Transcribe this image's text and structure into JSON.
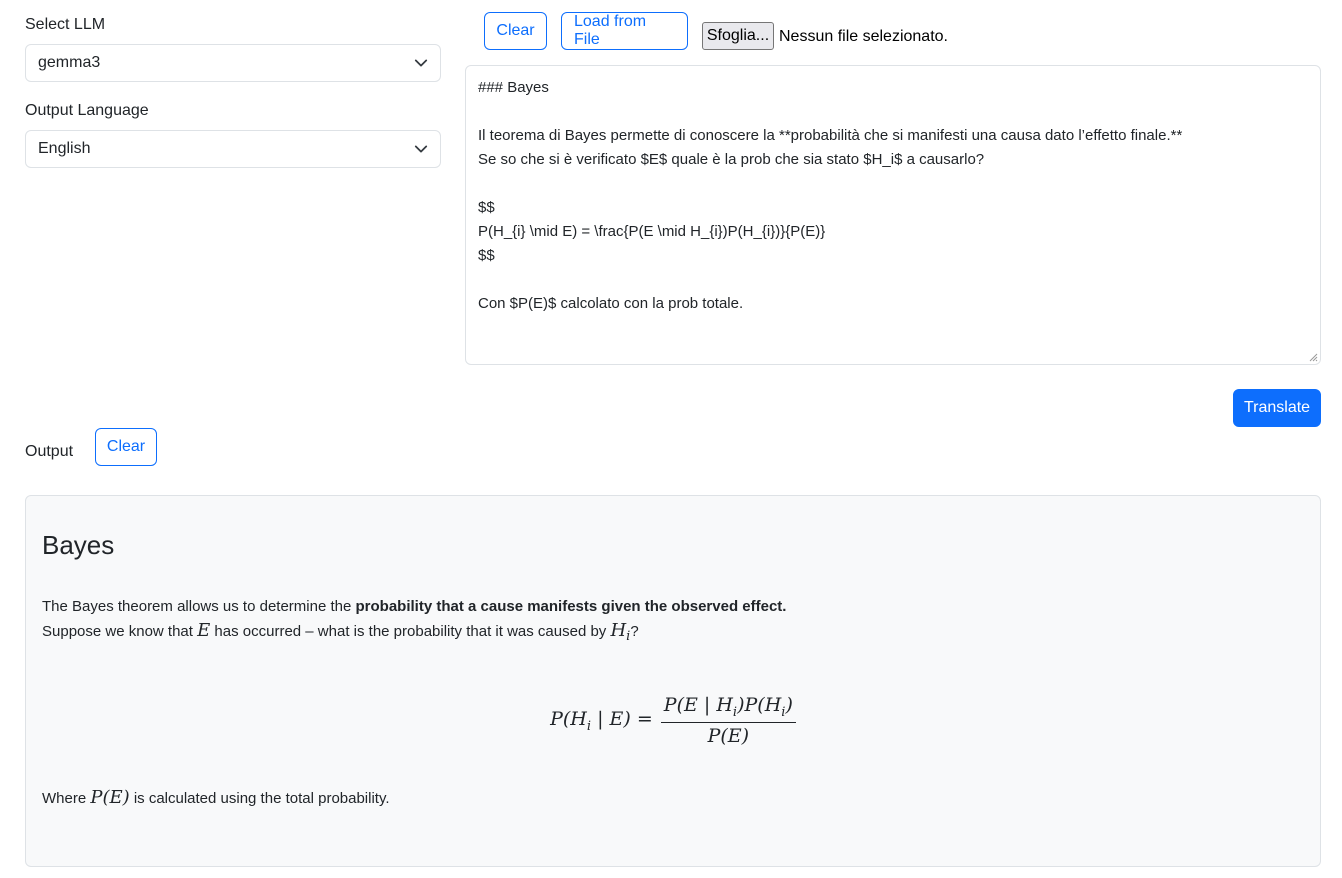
{
  "left_panel": {
    "llm_label": "Select LLM",
    "llm_selected": "gemma3",
    "language_label": "Output Language",
    "language_selected": "English"
  },
  "input_toolbar": {
    "clear_label": "Clear",
    "load_label": "Load from File",
    "browse_label": "Sfoglia...",
    "file_status": "Nessun file selezionato."
  },
  "input_text": {
    "lines": [
      "### Bayes",
      "",
      "Il teorema di Bayes permette di conoscere la **probabilità che si manifesti una causa dato l’effetto finale.**",
      "Se so che si è verificato $E$ quale è la prob che sia stato $H_i$ a causarlo?",
      "",
      "$$",
      "P(H_{i} \\mid E) = \\frac{P(E \\mid H_{i})P(H_{i})}{P(E)}",
      "$$",
      "",
      "Con $P(E)$ calcolato con la prob totale."
    ]
  },
  "translate_label": "Translate",
  "output": {
    "label": "Output",
    "clear_label": "Clear",
    "heading": "Bayes",
    "p1_text": "The Bayes theorem allows us to determine the ",
    "p1_bold": "probability that a cause manifests given the observed effect.",
    "p2_a": "Suppose we know that ",
    "p2_math_e": "E",
    "p2_b": " has occurred – what is the probability that it was caused by ",
    "p2_math_h": "H",
    "p2_math_sub": "i",
    "p2_c": "?",
    "formula": {
      "lhs_a": "P(H",
      "lhs_sub": "i",
      "lhs_b": " | E) =",
      "num_a": "P(E | H",
      "num_sub1": "i",
      "num_b": ")P(H",
      "num_sub2": "i",
      "num_c": ")",
      "den": "P(E)"
    },
    "p3_a": "Where ",
    "p3_math": "P(E)",
    "p3_b": " is calculated using the total probability."
  }
}
